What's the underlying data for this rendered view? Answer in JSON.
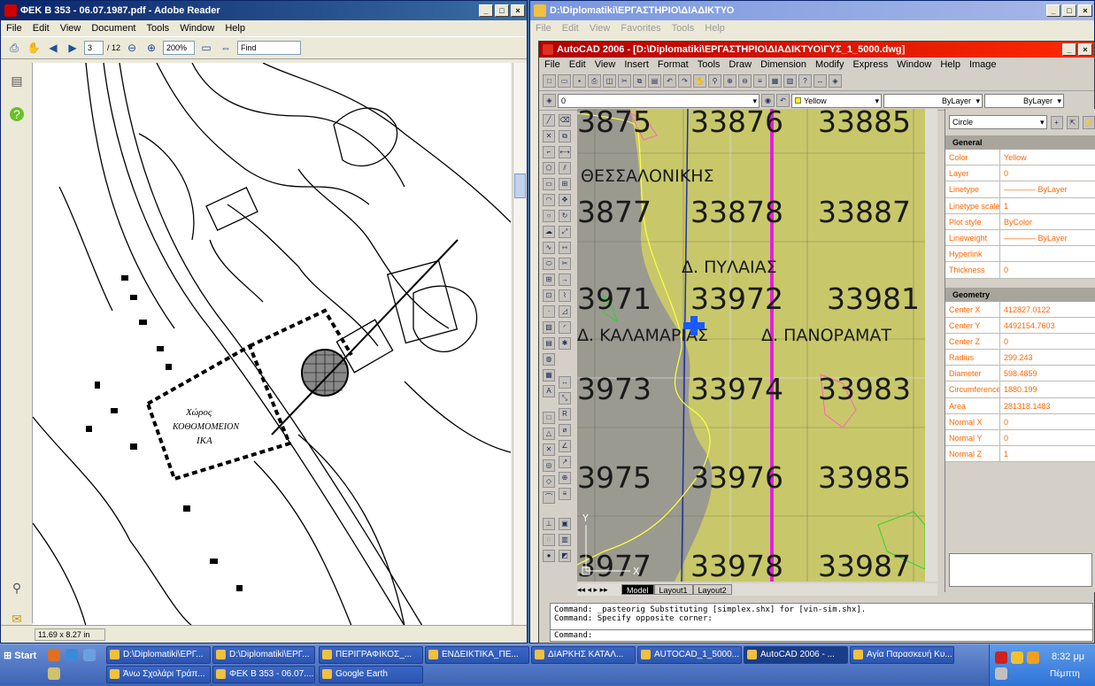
{
  "reader": {
    "title": "ΦΕΚ Β 353 - 06.07.1987.pdf - Adobe Reader",
    "menu": [
      "File",
      "Edit",
      "View",
      "Document",
      "Tools",
      "Window",
      "Help"
    ],
    "page_current": "3",
    "page_total": "/ 12",
    "zoom": "200%",
    "find_placeholder": "Find",
    "page_size": "11.69 x 8.27 in",
    "map_label_1": "Χώρος",
    "map_label_2": "ΚΟΘΟΜΟΜΕΙΟΝ",
    "map_label_3": "ΙΚΑ"
  },
  "explorer": {
    "title": "D:\\Diplomatiki\\ΕΡΓΑΣΤΗΡΙΟ\\ΔΙΑΔΙΚΤΥΟ",
    "menu": [
      "File",
      "Edit",
      "View",
      "Favorites",
      "Tools",
      "Help"
    ]
  },
  "acad": {
    "title": "AutoCAD 2006 - [D:\\Diplomatiki\\ΕΡΓΑΣΤΗΡΙΟ\\ΔΙΑΔΙΚΤΥΟ\\ΓΥΣ_1_5000.dwg]",
    "menu": [
      "File",
      "Edit",
      "View",
      "Insert",
      "Format",
      "Tools",
      "Draw",
      "Dimension",
      "Modify",
      "Express",
      "Window",
      "Help",
      "Image"
    ],
    "layer_value": "0",
    "color_value": "Yellow",
    "linetype_value": "ByLayer",
    "lineweight_value": "ByLayer",
    "tabs": [
      "Model",
      "Layout1",
      "Layout2"
    ],
    "drawing_labels": {
      "r1": [
        "3875",
        "33876",
        "33885"
      ],
      "r2": [
        "3877",
        "33878",
        "33887"
      ],
      "r3": [
        "3971",
        "33972",
        "33981"
      ],
      "r4": [
        "3973",
        "33974",
        "33983"
      ],
      "r5": [
        "3975",
        "33976",
        "33985"
      ],
      "r6": [
        "3977",
        "33978",
        "33987"
      ],
      "t1": "ΘΕΣΣΑΛΟΝΙΚΗΣ",
      "t2": "Δ. ΠΥΛΑΙΑΣ",
      "t3": "Δ. ΚΑΛΑΜΑΡΙΑΣ",
      "t4": "Δ. ΠΑΝΟΡΑΜΑΤ",
      "axis_y": "Y",
      "axis_x": "X"
    },
    "properties": {
      "object_type": "Circle",
      "general_header": "General",
      "general": [
        {
          "name": "Color",
          "value": "Yellow"
        },
        {
          "name": "Layer",
          "value": "0"
        },
        {
          "name": "Linetype",
          "value": "———— ByLayer"
        },
        {
          "name": "Linetype scale",
          "value": "1"
        },
        {
          "name": "Plot style",
          "value": "ByColor"
        },
        {
          "name": "Lineweight",
          "value": "———— ByLayer"
        },
        {
          "name": "Hyperlink",
          "value": ""
        },
        {
          "name": "Thickness",
          "value": "0"
        }
      ],
      "geometry_header": "Geometry",
      "geometry": [
        {
          "name": "Center X",
          "value": "412827.0122"
        },
        {
          "name": "Center Y",
          "value": "4492154.7603"
        },
        {
          "name": "Center Z",
          "value": "0"
        },
        {
          "name": "Radius",
          "value": "299.243"
        },
        {
          "name": "Diameter",
          "value": "598.4859"
        },
        {
          "name": "Circumference",
          "value": "1880.199"
        },
        {
          "name": "Area",
          "value": "281318.1483"
        },
        {
          "name": "Normal X",
          "value": "0"
        },
        {
          "name": "Normal Y",
          "value": "0"
        },
        {
          "name": "Normal Z",
          "value": "1"
        }
      ]
    },
    "command_lines": [
      "Command: _pasteorig Substituting [simplex.shx] for [vin-sim.shx].",
      "Command: Specify opposite corner:"
    ],
    "command_prompt": "Command:"
  },
  "taskbar": {
    "start": "Start",
    "buttons_row1": [
      "D:\\Diplomatiki\\ΕΡΓ...",
      "D:\\Diplomatiki\\ΕΡΓ...",
      "ΠΕΡΙΓΡΑΦΙΚΟΣ_...",
      "ΕΝΔΕΙΚΤΙΚΑ_ΠΕ...",
      "ΔΙΑΡΚΗΣ ΚΑΤΑΛ...",
      "AUTOCAD_1_5000...",
      "AutoCAD 2006 - ...",
      "Αγία Παρασκευή Κυ..."
    ],
    "buttons_row2": [
      "Άνω Σχολάρι Τράπ...",
      "ΦΕΚ Β 353 - 06.07....",
      "Google Earth"
    ],
    "clock": "8:32 μμ",
    "day": "Πέμπτη"
  }
}
